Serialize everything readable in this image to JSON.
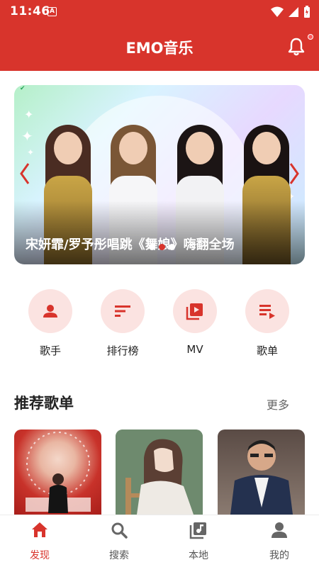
{
  "status_bar": {
    "time": "11:46",
    "notif_letter": "A"
  },
  "app_bar": {
    "title": "EMO音乐"
  },
  "banner": {
    "caption": "宋妍霏/罗予彤唱跳《舞娘》嗨翻全场",
    "slide_count": 3,
    "active_slide": 1
  },
  "quick_links": [
    {
      "label": "歌手",
      "icon": "person-icon"
    },
    {
      "label": "排行榜",
      "icon": "sort-icon"
    },
    {
      "label": "MV",
      "icon": "video-library-icon"
    },
    {
      "label": "歌单",
      "icon": "playlist-play-icon"
    }
  ],
  "recommend": {
    "title": "推荐歌单",
    "more": "更多"
  },
  "bottom_nav": [
    {
      "label": "发现",
      "icon": "home-icon",
      "active": true
    },
    {
      "label": "搜索",
      "icon": "search-icon",
      "active": false
    },
    {
      "label": "本地",
      "icon": "music-library-icon",
      "active": false
    },
    {
      "label": "我的",
      "icon": "account-icon",
      "active": false
    }
  ],
  "colors": {
    "primary": "#d8342c",
    "chip_bg": "#fbe3e1",
    "text": "#222222"
  }
}
